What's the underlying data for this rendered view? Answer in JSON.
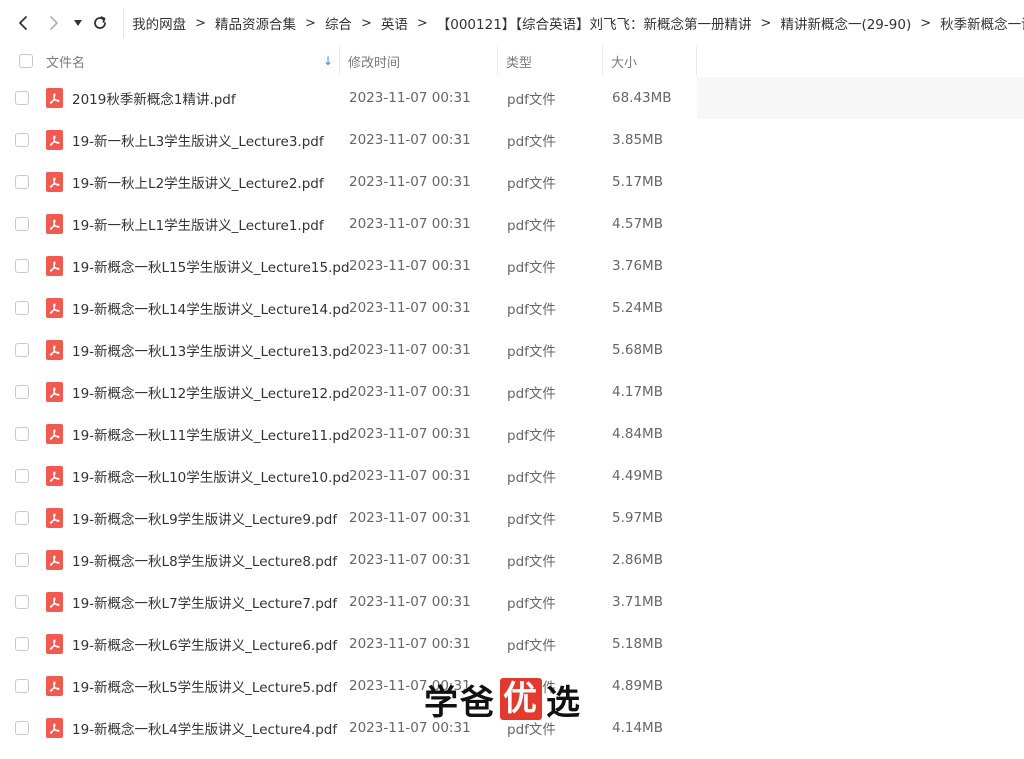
{
  "nav": {
    "back_icon": "chevron-left-icon",
    "forward_icon": "chevron-right-icon",
    "history_icon": "caret-down-icon",
    "refresh_icon": "refresh-icon"
  },
  "breadcrumb": [
    "我的网盘",
    "精品资源合集",
    "综合",
    "英语",
    "【000121】【综合英语】刘飞飞：新概念第一册精讲",
    "精讲新概念一(29-90)",
    "秋季新概念一讲义"
  ],
  "breadcrumb_separator": ">",
  "table": {
    "headers": {
      "name": "文件名",
      "time": "修改时间",
      "type": "类型",
      "size": "大小",
      "sort_icon": "↓"
    },
    "rows": [
      {
        "name": "2019秋季新概念1精讲.pdf",
        "time": "2023-11-07 00:31",
        "type": "pdf文件",
        "size": "68.43MB"
      },
      {
        "name": "19-新一秋上L3学生版讲义_Lecture3.pdf",
        "time": "2023-11-07 00:31",
        "type": "pdf文件",
        "size": "3.85MB"
      },
      {
        "name": "19-新一秋上L2学生版讲义_Lecture2.pdf",
        "time": "2023-11-07 00:31",
        "type": "pdf文件",
        "size": "5.17MB"
      },
      {
        "name": "19-新一秋上L1学生版讲义_Lecture1.pdf",
        "time": "2023-11-07 00:31",
        "type": "pdf文件",
        "size": "4.57MB"
      },
      {
        "name": "19-新概念一秋L15学生版讲义_Lecture15.pdf",
        "time": "2023-11-07 00:31",
        "type": "pdf文件",
        "size": "3.76MB"
      },
      {
        "name": "19-新概念一秋L14学生版讲义_Lecture14.pdf",
        "time": "2023-11-07 00:31",
        "type": "pdf文件",
        "size": "5.24MB"
      },
      {
        "name": "19-新概念一秋L13学生版讲义_Lecture13.pdf",
        "time": "2023-11-07 00:31",
        "type": "pdf文件",
        "size": "5.68MB"
      },
      {
        "name": "19-新概念一秋L12学生版讲义_Lecture12.pdf",
        "time": "2023-11-07 00:31",
        "type": "pdf文件",
        "size": "4.17MB"
      },
      {
        "name": "19-新概念一秋L11学生版讲义_Lecture11.pdf",
        "time": "2023-11-07 00:31",
        "type": "pdf文件",
        "size": "4.84MB"
      },
      {
        "name": "19-新概念一秋L10学生版讲义_Lecture10.pdf",
        "time": "2023-11-07 00:31",
        "type": "pdf文件",
        "size": "4.49MB"
      },
      {
        "name": "19-新概念一秋L9学生版讲义_Lecture9.pdf",
        "time": "2023-11-07 00:31",
        "type": "pdf文件",
        "size": "5.97MB"
      },
      {
        "name": "19-新概念一秋L8学生版讲义_Lecture8.pdf",
        "time": "2023-11-07 00:31",
        "type": "pdf文件",
        "size": "2.86MB"
      },
      {
        "name": "19-新概念一秋L7学生版讲义_Lecture7.pdf",
        "time": "2023-11-07 00:31",
        "type": "pdf文件",
        "size": "3.71MB"
      },
      {
        "name": "19-新概念一秋L6学生版讲义_Lecture6.pdf",
        "time": "2023-11-07 00:31",
        "type": "pdf文件",
        "size": "5.18MB"
      },
      {
        "name": "19-新概念一秋L5学生版讲义_Lecture5.pdf",
        "time": "2023-11-07 00:31",
        "type": "pdf文件",
        "size": "4.89MB"
      },
      {
        "name": "19-新概念一秋L4学生版讲义_Lecture4.pdf",
        "time": "2023-11-07 00:31",
        "type": "pdf文件",
        "size": "4.14MB"
      }
    ],
    "file_icon": "pdf-file-icon"
  },
  "watermark": {
    "part1": "学爸",
    "boxed": "优",
    "part2": "选"
  },
  "colors": {
    "accent": "#2f8cf5",
    "pdf_icon": "#f05a4f",
    "watermark_box": "#e23a2e"
  }
}
